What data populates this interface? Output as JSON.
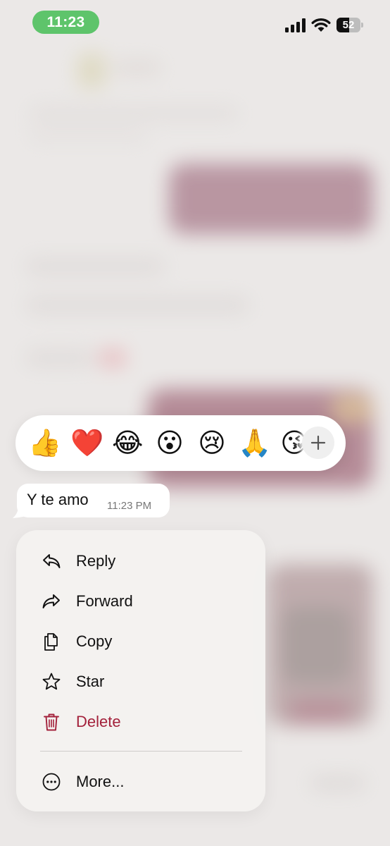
{
  "status_bar": {
    "time": "11:23",
    "battery_level": "52",
    "battery_fraction": 0.52
  },
  "reactions": {
    "emojis": [
      "👍",
      "❤️",
      "😂",
      "😮",
      "😢",
      "🙏",
      "😘"
    ],
    "add_icon": "plus-icon"
  },
  "message": {
    "text": "Y te amo",
    "time": "11:23 PM"
  },
  "menu": {
    "items": [
      {
        "label": "Reply",
        "icon": "reply-icon"
      },
      {
        "label": "Forward",
        "icon": "forward-icon"
      },
      {
        "label": "Copy",
        "icon": "copy-icon"
      },
      {
        "label": "Star",
        "icon": "star-icon"
      },
      {
        "label": "Delete",
        "icon": "trash-icon",
        "color": "#a3213b"
      },
      {
        "label": "More...",
        "icon": "more-icon"
      }
    ]
  },
  "colors": {
    "status_pill": "#5ec46b",
    "delete": "#a3213b"
  }
}
